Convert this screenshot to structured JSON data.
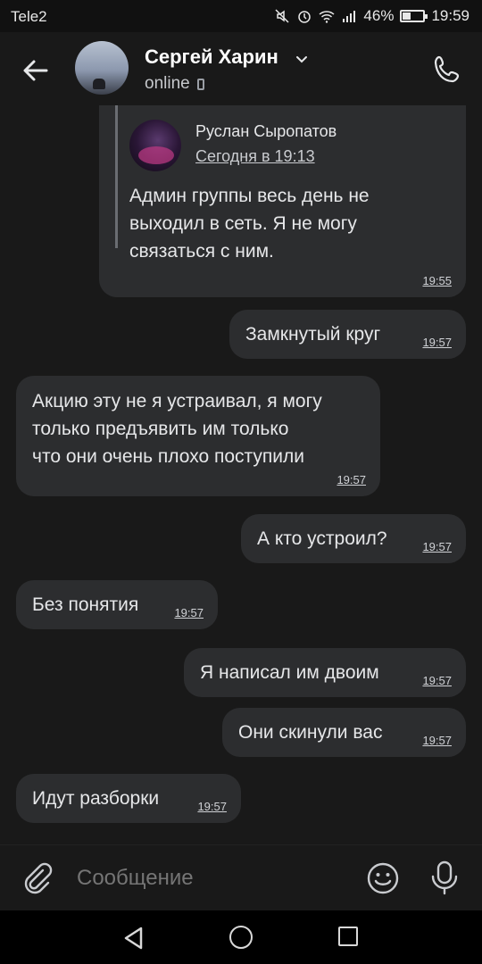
{
  "status_bar": {
    "carrier": "Tele2",
    "battery_text": "46%",
    "battery_level": 0.46,
    "time": "19:59",
    "icons": [
      "mute-icon",
      "alarm-icon",
      "wifi-icon",
      "signal-icon",
      "battery-icon"
    ]
  },
  "header": {
    "name": "Сергей Харин",
    "status": "online",
    "icons": [
      "back-arrow-icon",
      "chevron-down-icon",
      "mobile-device-icon",
      "phone-call-icon"
    ]
  },
  "messages": [
    {
      "side": "right",
      "forwarded": {
        "author": "Руслан Сыропатов",
        "date": "Сегодня в 19:13",
        "text": [
          "Админ группы весь день не",
          "выходил в сеть. Я не могу",
          "связаться с ним."
        ]
      },
      "time": "19:55"
    },
    {
      "side": "right",
      "text": "Замкнутый круг",
      "time": "19:57"
    },
    {
      "side": "left",
      "text": [
        "Акцию эту не я устраивал, я могу",
        "только предъявить им только",
        "что они очень плохо поступили"
      ],
      "time": "19:57"
    },
    {
      "side": "right",
      "text": "А кто устроил?",
      "time": "19:57"
    },
    {
      "side": "left",
      "text": "Без понятия",
      "time": "19:57"
    },
    {
      "side": "right",
      "text": "Я написал им двоим",
      "time": "19:57"
    },
    {
      "side": "right",
      "text": "Они скинули вас",
      "time": "19:57"
    },
    {
      "side": "left",
      "text": "Идут разборки",
      "time": "19:57"
    }
  ],
  "composer": {
    "placeholder": "Сообщение",
    "icons": [
      "paperclip-icon",
      "emoji-icon",
      "microphone-icon"
    ]
  },
  "nav_bar": {
    "icons": [
      "nav-back-icon",
      "nav-home-icon",
      "nav-recents-icon"
    ]
  },
  "colors": {
    "background": "#191919",
    "bubble": "#2c2d2f",
    "text": "#e6e7e9"
  }
}
